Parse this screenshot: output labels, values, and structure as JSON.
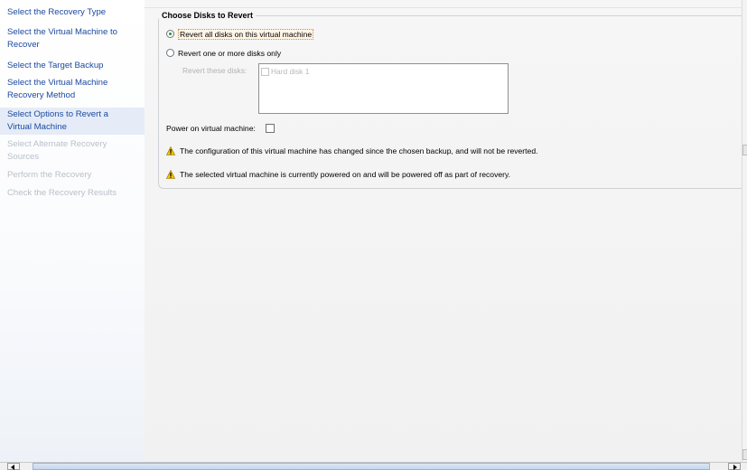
{
  "sidebar": {
    "items": [
      {
        "label_lines": [
          "Select the Recovery Type"
        ],
        "state": "normal"
      },
      {
        "label_lines": [
          "Select the Virtual Machine to",
          "Recover"
        ],
        "state": "normal"
      },
      {
        "label_lines": [
          "Select the Target Backup"
        ],
        "state": "normal"
      },
      {
        "label_lines": [
          "Select the Virtual Machine",
          "Recovery Method"
        ],
        "state": "normal"
      },
      {
        "label_lines": [
          "Select Options to Revert a",
          "Virtual Machine"
        ],
        "state": "active"
      },
      {
        "label_lines": [
          "Select Alternate Recovery",
          "Sources"
        ],
        "state": "disabled"
      },
      {
        "label_lines": [
          "Perform the Recovery"
        ],
        "state": "disabled"
      },
      {
        "label_lines": [
          "Check the Recovery Results"
        ],
        "state": "disabled"
      }
    ]
  },
  "group": {
    "title": "Choose Disks to Revert",
    "radio_all": {
      "label": "Revert all disks on this virtual machine",
      "checked": true
    },
    "radio_some": {
      "label": "Revert one or more disks only",
      "checked": false
    },
    "disk_list_label": "Revert these disks:",
    "disks": [
      {
        "name": "Hard disk 1",
        "checked": false
      }
    ],
    "power_label": "Power on virtual machine:",
    "power_checked": false,
    "warnings": [
      "The configuration of this virtual machine has changed since the chosen backup, and will not be reverted.",
      "The selected virtual machine is currently powered on and will be powered off as part of recovery."
    ]
  },
  "colors": {
    "nav_link": "#1c4aa0",
    "nav_disabled": "#b9c0c9",
    "warning_yellow": "#f2c500"
  },
  "icons": [
    "warning-icon",
    "scroll-left-icon",
    "scroll-right-icon"
  ]
}
